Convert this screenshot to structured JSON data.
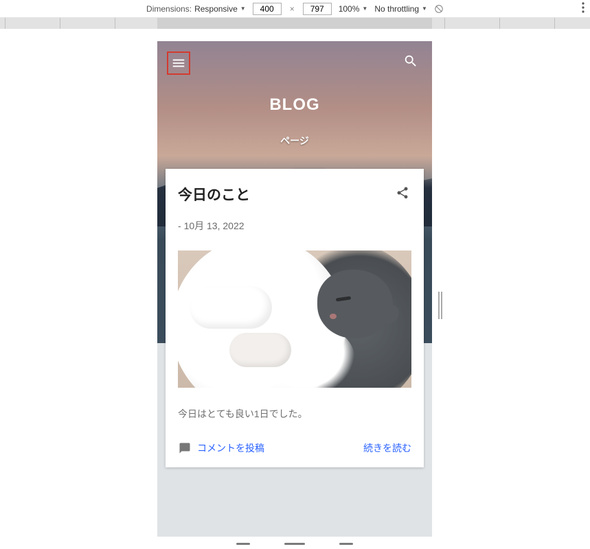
{
  "devtools": {
    "dimensions_label": "Dimensions:",
    "responsive_label": "Responsive",
    "width_value": "400",
    "height_value": "797",
    "dim_separator": "×",
    "zoom_label": "100%",
    "throttling_label": "No throttling"
  },
  "blog": {
    "title": "BLOG",
    "subtitle": "ページ"
  },
  "post": {
    "title": "今日のこと",
    "date_prefix": "- ",
    "date": "10月 13, 2022",
    "excerpt": "今日はとても良い1日でした。",
    "comment_label": "コメントを投稿",
    "readmore_label": "続きを読む"
  }
}
